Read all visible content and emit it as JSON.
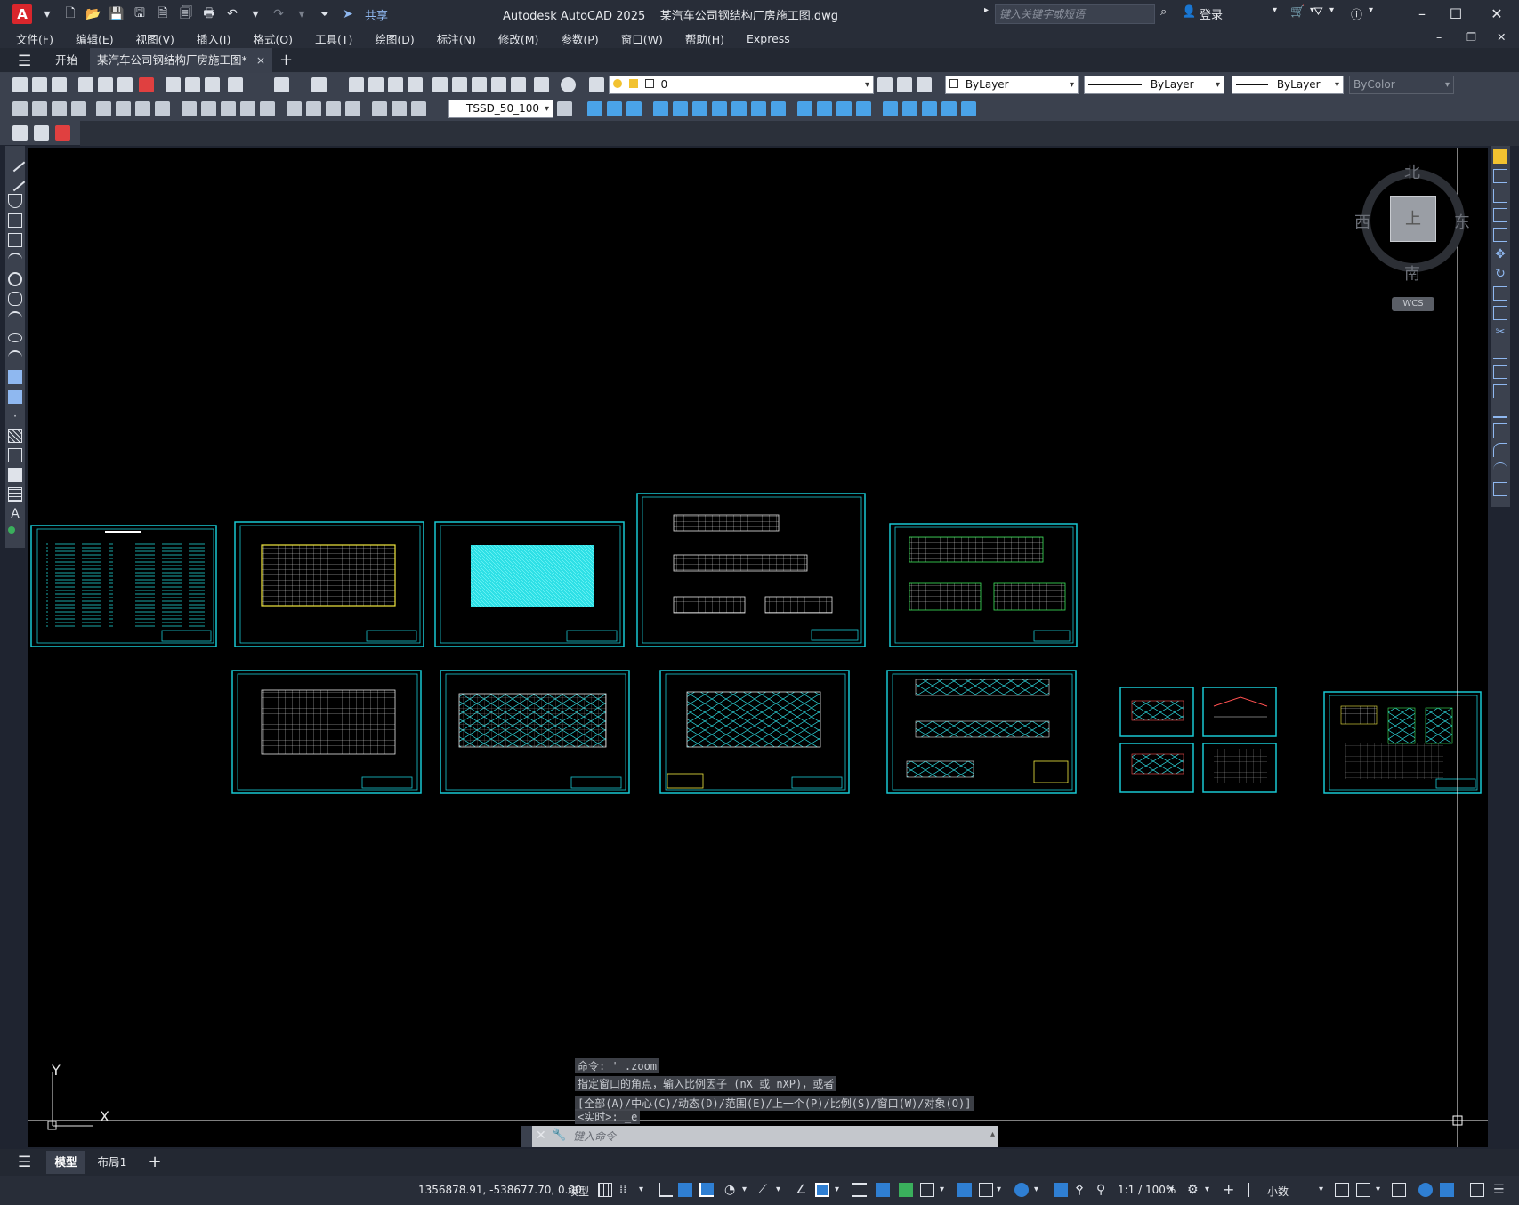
{
  "app": {
    "logo_letter": "A",
    "share_label": "共享",
    "title": "Autodesk AutoCAD 2025    某汽车公司钢结构厂房施工图.dwg",
    "search_placeholder": "键入关键字或短语",
    "login_label": "登录"
  },
  "menu": [
    "文件(F)",
    "编辑(E)",
    "视图(V)",
    "插入(I)",
    "格式(O)",
    "工具(T)",
    "绘图(D)",
    "标注(N)",
    "修改(M)",
    "参数(P)",
    "窗口(W)",
    "帮助(H)",
    "Express"
  ],
  "tabs": {
    "start": "开始",
    "drawing": "某汽车公司钢结构厂房施工图*",
    "close": "×",
    "add": "+"
  },
  "toolbar": {
    "layer_value": "0",
    "color_value": "ByLayer",
    "linetype_value": "ByLayer",
    "lineweight_value": "ByLayer",
    "plotstyle_value": "ByColor",
    "dimstyle_value": "TSSD_50_100"
  },
  "viewcube": {
    "north": "北",
    "south": "南",
    "west": "西",
    "east": "东",
    "face": "上",
    "wcs": "WCS"
  },
  "ucs": {
    "x_label": "X",
    "y_label": "Y"
  },
  "command_history": [
    "命令: '_.zoom",
    "指定窗口的角点，输入比例因子 (nX 或 nXP)，或者",
    "[全部(A)/中心(C)/动态(D)/范围(E)/上一个(P)/比例(S)/窗口(W)/对象(O)]",
    "<实时>: _e"
  ],
  "command_input_placeholder": "键入命令",
  "layout_tabs": {
    "model": "模型",
    "layout1": "布局1",
    "add": "+"
  },
  "status": {
    "coordinates": "1356878.91, -538677.70, 0.00",
    "model_label": "模型",
    "scale": "1:1 / 100%",
    "units": "小数"
  },
  "colors": {
    "sheet_border": "#19c8d2",
    "canvas_bg": "#000000",
    "ui_dark": "#282d38",
    "toolbar_bg": "#3b414e"
  }
}
